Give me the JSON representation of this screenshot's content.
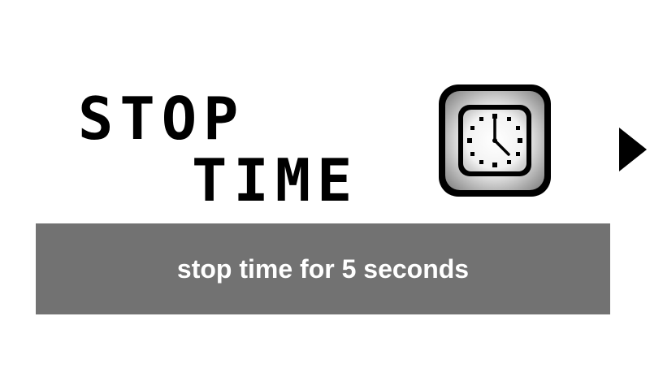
{
  "powerup": {
    "title_line1": "STOP",
    "title_line2": "TIME",
    "icon": "clock-icon",
    "description": "stop time for 5 seconds"
  },
  "navigation": {
    "next_icon": "play-arrow-right-icon"
  },
  "colors": {
    "background": "#ffffff",
    "title": "#000000",
    "description_bar": "#727272",
    "description_text": "#ffffff"
  }
}
